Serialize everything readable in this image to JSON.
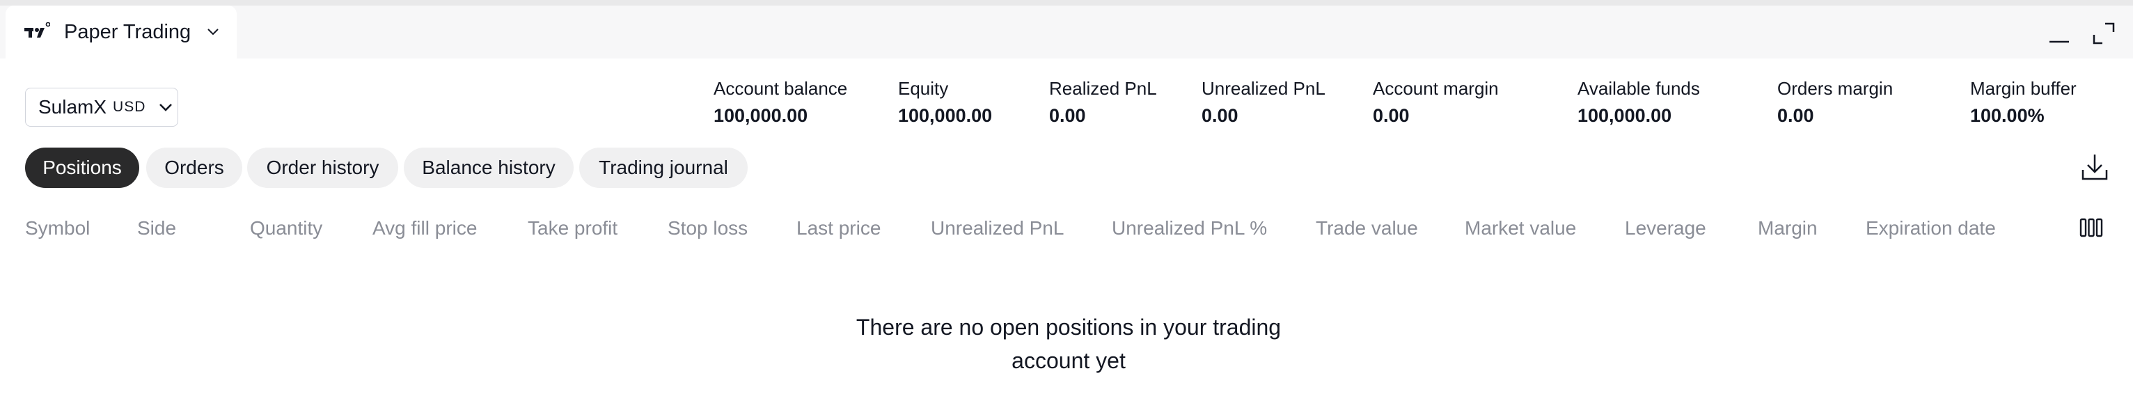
{
  "window": {
    "tab_title": "Paper Trading",
    "icons": [
      "tradingview-logo-icon",
      "chevron-down-icon",
      "minimize-icon",
      "maximize-icon"
    ]
  },
  "account": {
    "name": "SulamX",
    "currency": "USD"
  },
  "metrics": [
    {
      "label": "Account balance",
      "value": "100,000.00"
    },
    {
      "label": "Equity",
      "value": "100,000.00"
    },
    {
      "label": "Realized PnL",
      "value": "0.00"
    },
    {
      "label": "Unrealized PnL",
      "value": "0.00"
    },
    {
      "label": "Account margin",
      "value": "0.00"
    },
    {
      "label": "Available funds",
      "value": "100,000.00"
    },
    {
      "label": "Orders margin",
      "value": "0.00"
    },
    {
      "label": "Margin buffer",
      "value": "100.00%"
    }
  ],
  "tabs": [
    {
      "label": "Positions",
      "active": true
    },
    {
      "label": "Orders",
      "active": false
    },
    {
      "label": "Order history",
      "active": false
    },
    {
      "label": "Balance history",
      "active": false
    },
    {
      "label": "Trading journal",
      "active": false
    }
  ],
  "columns": [
    "Symbol",
    "Side",
    "Quantity",
    "Avg fill price",
    "Take profit",
    "Stop loss",
    "Last price",
    "Unrealized PnL",
    "Unrealized PnL %",
    "Trade value",
    "Market value",
    "Leverage",
    "Margin",
    "Expiration date"
  ],
  "empty_state": {
    "line1": "There are no open positions in your trading",
    "line2": "account yet"
  },
  "colors": {
    "active_tab_bg": "#2a2a2b",
    "pill_bg": "#f0f0f1",
    "header_text_muted": "#8a8d96"
  }
}
